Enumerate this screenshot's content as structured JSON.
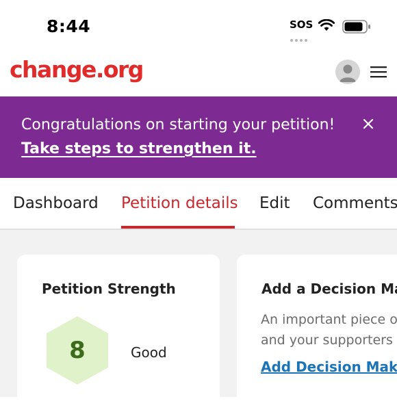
{
  "status_bar": {
    "time": "8:44",
    "carrier": "SOS",
    "wifi_icon": "wifi-icon",
    "battery_icon": "battery-icon"
  },
  "header": {
    "logo_text": "change.org",
    "logo_color": "#e12b2b",
    "avatar_icon": "user-avatar-icon",
    "menu_icon": "hamburger-menu-icon"
  },
  "banner": {
    "message": "Congratulations on starting your petition!",
    "link": "Take steps to strengthen it.",
    "close_icon": "close-icon",
    "background_color": "#7d2a92"
  },
  "tabs": {
    "items": [
      {
        "label": "Dashboard",
        "active": false
      },
      {
        "label": "Petition details",
        "active": true
      },
      {
        "label": "Edit",
        "active": false
      },
      {
        "label": "Comments",
        "active": false
      }
    ],
    "active_color": "#c8282d"
  },
  "strength_card": {
    "title": "Petition Strength",
    "score": "8",
    "rating": "Good",
    "badge_color": "#dff2c9"
  },
  "decision_card": {
    "title": "Add a Decision Mak",
    "description_lines": [
      "An important piece o",
      "and your supporters"
    ],
    "link": "Add Decision Maker",
    "link_color": "#1b73b8"
  }
}
